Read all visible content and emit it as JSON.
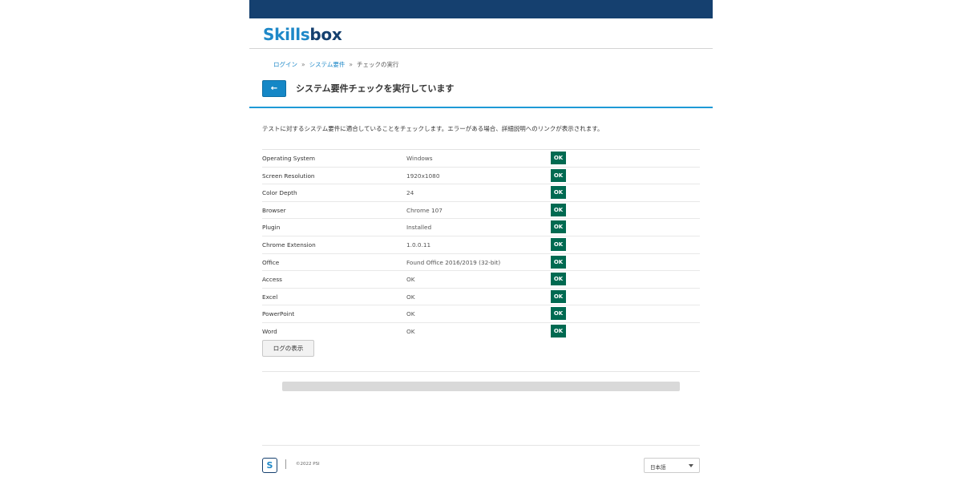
{
  "brand": {
    "logo_part1": "Skills",
    "logo_part2": "box",
    "footer_logo_glyph": "S"
  },
  "breadcrumb": [
    {
      "label": "ログイン",
      "link": true
    },
    {
      "label": "システム要件",
      "link": true
    },
    {
      "label": "チェックの実行",
      "link": false
    }
  ],
  "breadcrumb_separator": "»",
  "header": {
    "back_icon": "←",
    "title": "システム要件チェックを実行しています"
  },
  "intro": "テストに対するシステム要件に適合していることをチェックします。エラーがある場合、詳細説明へのリンクが表示されます。",
  "requirements": [
    {
      "name": "Operating System",
      "value": "Windows",
      "status": "OK"
    },
    {
      "name": "Screen Resolution",
      "value": "1920x1080",
      "status": "OK"
    },
    {
      "name": "Color Depth",
      "value": "24",
      "status": "OK"
    },
    {
      "name": "Browser",
      "value": "Chrome 107",
      "status": "OK"
    },
    {
      "name": "Plugin",
      "value": "Installed",
      "status": "OK"
    },
    {
      "name": "Chrome Extension",
      "value": "1.0.0.11",
      "status": "OK"
    },
    {
      "name": "Office",
      "value": "Found Office 2016/2019 (32-bit)",
      "status": "OK"
    },
    {
      "name": "Access",
      "value": "OK",
      "status": "OK"
    },
    {
      "name": "Excel",
      "value": "OK",
      "status": "OK"
    },
    {
      "name": "PowerPoint",
      "value": "OK",
      "status": "OK"
    },
    {
      "name": "Word",
      "value": "OK",
      "status": "OK"
    }
  ],
  "log_button": "ログの表示",
  "progress": {
    "fraction": 0
  },
  "footer": {
    "copyright": "©2022 PSI",
    "language": "日本語"
  },
  "colors": {
    "topbar": "#15406f",
    "accent": "#1e9ad6",
    "ok_badge": "#006a51"
  }
}
